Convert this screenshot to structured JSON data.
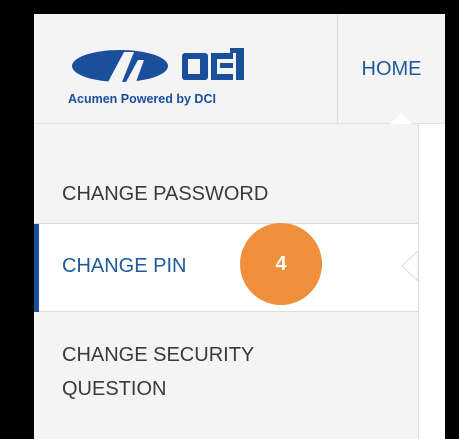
{
  "header": {
    "logo_brand": "DCI",
    "logo_tagline": "Acumen Powered by DCI",
    "nav_home": "HOME"
  },
  "menu": {
    "items": [
      {
        "label": "CHANGE PASSWORD",
        "active": false
      },
      {
        "label": "CHANGE PIN",
        "active": true
      },
      {
        "label": "CHANGE SECURITY QUESTION",
        "active": false
      }
    ]
  },
  "annotation": {
    "step": "4"
  },
  "colors": {
    "brand_blue": "#1a4f9c",
    "link_blue": "#1f5a9a",
    "badge_orange": "#ef8f3b",
    "menu_bg": "#f4f4f4",
    "active_bg": "#ffffff"
  }
}
